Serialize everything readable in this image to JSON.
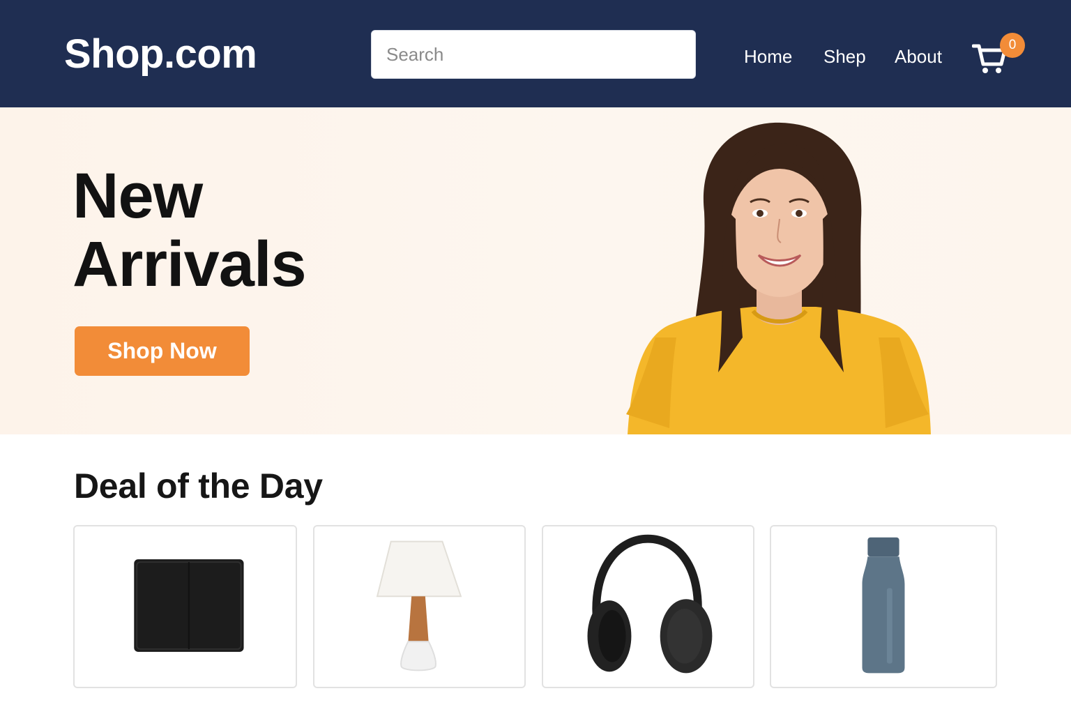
{
  "header": {
    "logo": "Shop.com",
    "search_placeholder": "Search",
    "nav": [
      "Home",
      "Shep",
      "About"
    ],
    "cart_count": "0"
  },
  "hero": {
    "title_line1": "New",
    "title_line2": "Arrivals",
    "cta_label": "Shop Now"
  },
  "deals": {
    "title": "Deal of the Day",
    "products": [
      "wallet",
      "table-lamp",
      "headphones",
      "water-bottle"
    ]
  },
  "colors": {
    "header_bg": "#1f2e52",
    "accent": "#f28c38",
    "hero_bg": "#fdf4ec"
  }
}
